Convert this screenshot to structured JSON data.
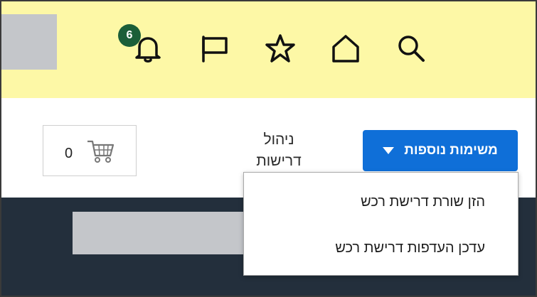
{
  "header": {
    "icons": {
      "search": "search-icon",
      "home": "home-icon",
      "favorites": "star-icon",
      "flag": "flag-icon",
      "notifications": "bell-icon"
    },
    "notifications_count": "6",
    "background_color": "#fdf8a6",
    "badge_color": "#1b5e38"
  },
  "toolbar": {
    "more_lists_label": "משימות נוספות",
    "manage_requisitions_label_line1": "ניהול",
    "manage_requisitions_label_line2": "דרישות",
    "cart_count": "0",
    "accent_color": "#0f6fd8"
  },
  "dropdown": {
    "items": [
      {
        "label": "הזן שורת דרישת רכש"
      },
      {
        "label": "עדכן העדפות דרישת רכש"
      }
    ]
  },
  "footer": {
    "background_color": "#232f3c"
  }
}
